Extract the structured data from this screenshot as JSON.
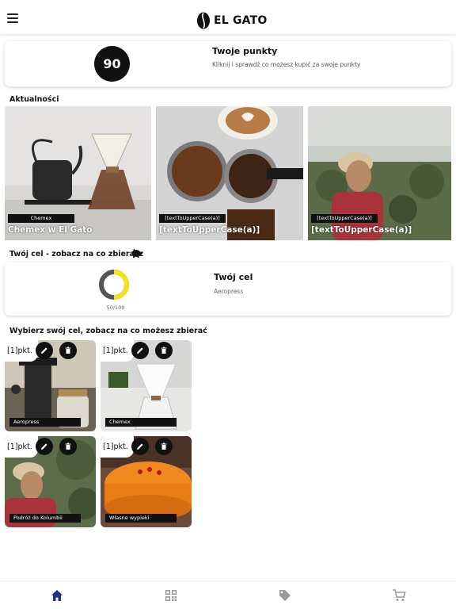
{
  "header": {
    "logo_text": "EL GATO",
    "menu_icon": "hamburger-menu-icon",
    "logo_icon": "coffee-bean-icon"
  },
  "points": {
    "value": "90",
    "title": "Twoje punkty",
    "subtitle": "Kliknij i sprawdź co możesz kupić za swoje punkty"
  },
  "news": {
    "section_title": "Aktualności",
    "items": [
      {
        "tag": "Chemex",
        "title": "Chemex w El Gato"
      },
      {
        "tag": "[textToUpperCase(a)]",
        "title": "[textToUpperCase(a)]"
      },
      {
        "tag": "[textToUpperCase(a)]",
        "title": "[textToUpperCase(a)]"
      }
    ]
  },
  "goal": {
    "section_title": "Twój cel - zobacz na co zbierasz",
    "section_icon": "piggy-bank-icon",
    "title": "Twój cel",
    "name": "Aeropress",
    "progress_text": "50/100",
    "progress_fraction": 0.5,
    "ring_color": "#f5e01e"
  },
  "goals_grid": {
    "section_title": "Wybierz swój cel, zobacz na co możesz zbierać",
    "items": [
      {
        "points": "[1]pkt.",
        "label": "Aeropress",
        "edit_icon": "pencil-icon",
        "delete_icon": "trash-icon"
      },
      {
        "points": "[1]pkt.",
        "label": "Chemex",
        "edit_icon": "pencil-icon",
        "delete_icon": "trash-icon"
      },
      {
        "points": "[1]pkt.",
        "label": "Podróż do Kolumbii",
        "edit_icon": "pencil-icon",
        "delete_icon": "trash-icon"
      },
      {
        "points": "[1]pkt.",
        "label": "Własne wypieki",
        "edit_icon": "pencil-icon",
        "delete_icon": "trash-icon"
      }
    ]
  },
  "bottom_nav": {
    "items": [
      {
        "icon": "home-icon",
        "active": true
      },
      {
        "icon": "qr-code-icon",
        "active": false
      },
      {
        "icon": "tags-icon",
        "active": false
      },
      {
        "icon": "cart-icon",
        "active": false
      }
    ],
    "active_color": "#1f2f86",
    "inactive_color": "#9a9a9a"
  }
}
